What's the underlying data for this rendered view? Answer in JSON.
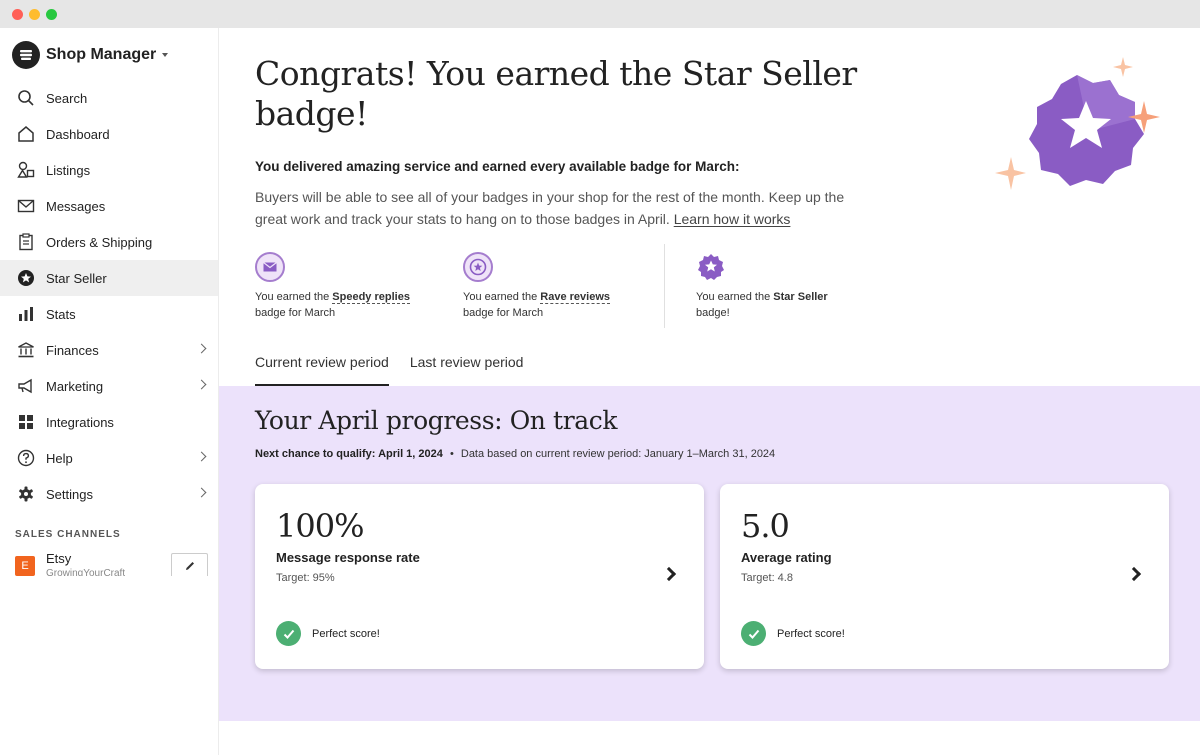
{
  "app": {
    "title": "Shop Manager"
  },
  "sidebar": {
    "items": [
      {
        "label": "Search",
        "icon": "search-icon"
      },
      {
        "label": "Dashboard",
        "icon": "home-icon"
      },
      {
        "label": "Listings",
        "icon": "shapes-icon"
      },
      {
        "label": "Messages",
        "icon": "envelope-icon"
      },
      {
        "label": "Orders & Shipping",
        "icon": "clipboard-icon"
      },
      {
        "label": "Star Seller",
        "icon": "star-badge-icon",
        "active": true
      },
      {
        "label": "Stats",
        "icon": "bar-chart-icon"
      },
      {
        "label": "Finances",
        "icon": "bank-icon",
        "has_submenu": true
      },
      {
        "label": "Marketing",
        "icon": "megaphone-icon",
        "has_submenu": true
      },
      {
        "label": "Integrations",
        "icon": "grid-icon"
      },
      {
        "label": "Help",
        "icon": "question-icon",
        "has_submenu": true
      },
      {
        "label": "Settings",
        "icon": "gear-icon",
        "has_submenu": true
      }
    ],
    "channels_title": "SALES CHANNELS",
    "channel": {
      "badge": "E",
      "name": "Etsy",
      "shop": "GrowingYourCraft"
    }
  },
  "hero": {
    "title": "Congrats! You earned the Star Seller badge!",
    "subtitle": "You delivered amazing service and earned every available badge for March:",
    "body": "Buyers will be able to see all of your badges in your shop for the rest of the month. Keep up the great work and track your stats to hang on to those badges in April.",
    "link": "Learn how it works"
  },
  "badges": [
    {
      "prefix": "You earned the ",
      "name": "Speedy replies",
      "suffix": "badge for March",
      "icon": "envelope-badge-icon"
    },
    {
      "prefix": "You earned the ",
      "name": "Rave reviews",
      "suffix": "badge for March",
      "icon": "star-badge-icon"
    },
    {
      "prefix": "You earned the ",
      "name": "Star Seller",
      "suffix": "badge!",
      "icon": "star-seller-icon"
    }
  ],
  "tabs": [
    {
      "label": "Current review period",
      "active": true
    },
    {
      "label": "Last review period",
      "active": false
    }
  ],
  "progress": {
    "title": "Your April progress: On track",
    "next_chance_label": "Next chance to qualify: April 1, 2024",
    "separator": "•",
    "data_note": "Data based on current review period: January 1–March 31, 2024"
  },
  "cards": [
    {
      "value": "100%",
      "label": "Message response rate",
      "target": "Target: 95%",
      "status": "Perfect score!"
    },
    {
      "value": "5.0",
      "label": "Average rating",
      "target": "Target: 4.8",
      "status": "Perfect score!"
    }
  ],
  "colors": {
    "accent_purple": "#8a5cc4",
    "progress_bg": "#ece2fb",
    "success_green": "#4caf73",
    "etsy_orange": "#f1641e",
    "sparkle_orange": "#f6a07a"
  }
}
